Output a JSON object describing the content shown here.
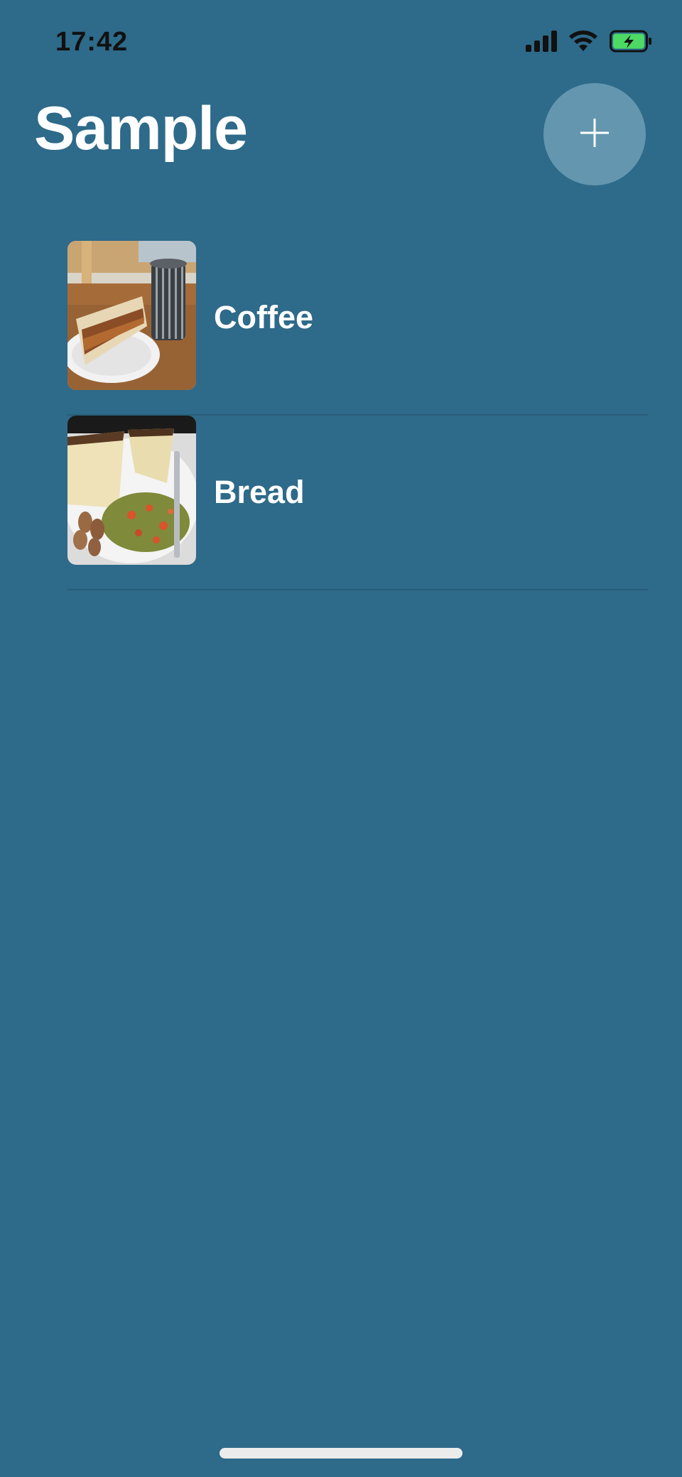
{
  "status_bar": {
    "time": "17:42",
    "icons": [
      "cellular-signal-icon",
      "wifi-icon",
      "battery-charging-icon"
    ]
  },
  "header": {
    "title": "Sample",
    "add_button_icon": "plus-icon"
  },
  "items": [
    {
      "label": "Coffee",
      "thumbnail": "sandwich-and-coffee-photo"
    },
    {
      "label": "Bread",
      "thumbnail": "bread-and-salad-photo"
    }
  ],
  "colors": {
    "background": "#2e6a8a",
    "add_button": "#6497af",
    "text": "#ffffff",
    "battery": "#4cd964"
  }
}
